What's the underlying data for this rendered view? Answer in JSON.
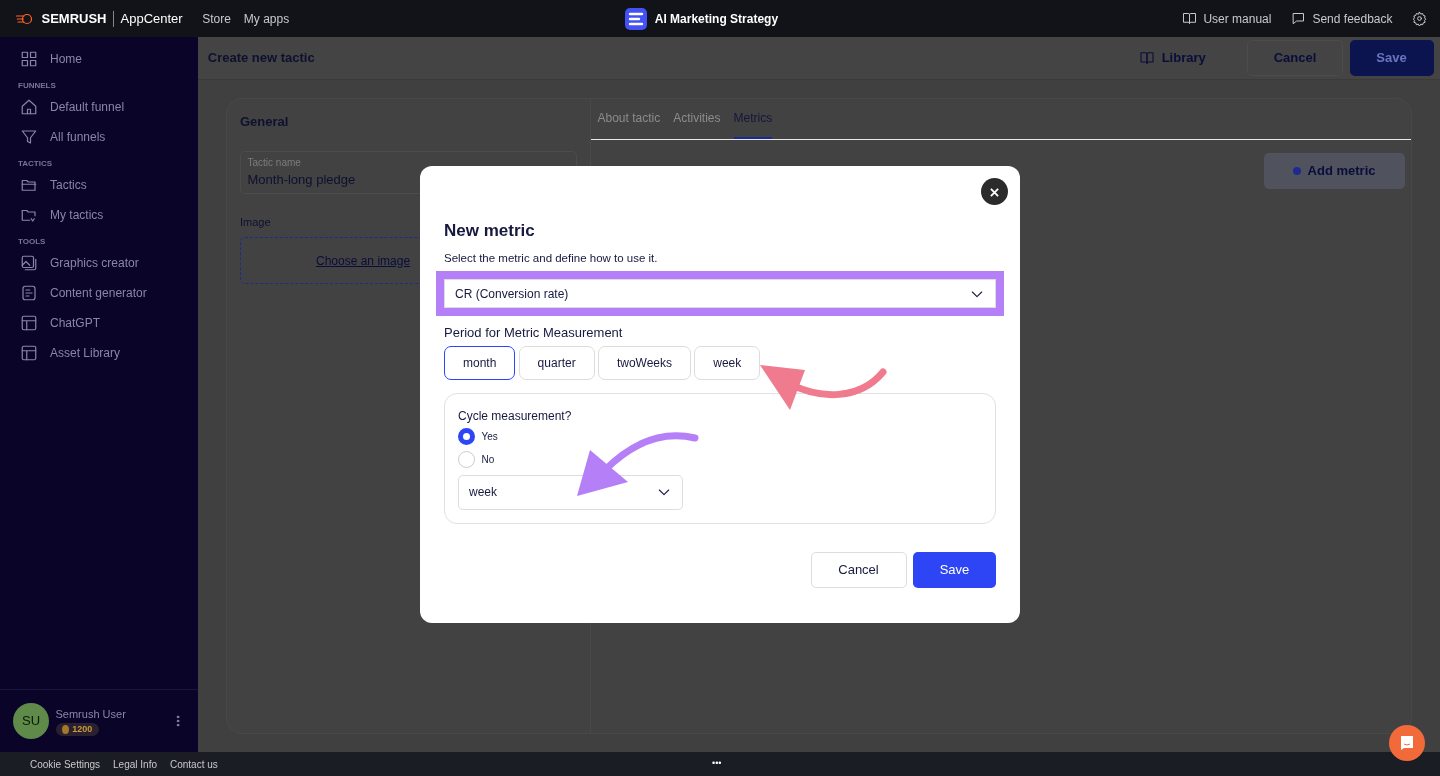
{
  "topbar": {
    "brand": "SEMRUSH",
    "brand_suffix": "AppCenter",
    "nav": [
      "Store",
      "My apps"
    ],
    "app_title": "AI Marketing Strategy",
    "links": [
      {
        "kind": "manual",
        "label": "User manual"
      },
      {
        "kind": "feedback",
        "label": "Send feedback"
      }
    ]
  },
  "sidebar": {
    "sections": [
      {
        "items": [
          {
            "kind": "grid",
            "label": "Home"
          }
        ]
      },
      {
        "heading": "FUNNELS",
        "items": [
          {
            "kind": "house",
            "label": "Default funnel"
          },
          {
            "kind": "funnel",
            "label": "All funnels"
          }
        ]
      },
      {
        "heading": "TACTICS",
        "items": [
          {
            "kind": "folder",
            "label": "Tactics"
          },
          {
            "kind": "folder-my",
            "label": "My tactics"
          }
        ]
      },
      {
        "heading": "TOOLS",
        "items": [
          {
            "kind": "picture",
            "label": "Graphics creator"
          },
          {
            "kind": "doc",
            "label": "Content generator"
          },
          {
            "kind": "layout",
            "label": "ChatGPT"
          },
          {
            "kind": "layout",
            "label": "Asset Library"
          }
        ]
      }
    ],
    "user": {
      "initials": "SU",
      "name": "Semrush User",
      "credits": "1200"
    }
  },
  "page": {
    "title": "Create new tactic",
    "library": "Library",
    "cancel": "Cancel",
    "save": "Save"
  },
  "general": {
    "heading": "General",
    "field_label": "Tactic name",
    "field_value": "Month-long pledge",
    "image_label": "Image",
    "upload_link": "Choose an image"
  },
  "tabs": [
    {
      "label": "About tactic",
      "selected": false
    },
    {
      "label": "Activities",
      "selected": false
    },
    {
      "label": "Metrics",
      "selected": true
    }
  ],
  "add_metric": "Add metric",
  "modal": {
    "title": "New metric",
    "subtitle": "Select the metric and define how to use it.",
    "metric": "CR (Conversion rate)",
    "period_label": "Period for Metric Measurement",
    "periods": [
      {
        "label": "month",
        "selected": true
      },
      {
        "label": "quarter",
        "selected": false
      },
      {
        "label": "twoWeeks",
        "selected": false
      },
      {
        "label": "week",
        "selected": false
      }
    ],
    "cycle_label": "Cycle measurement?",
    "cycle_options": [
      {
        "label": "Yes",
        "selected": true
      },
      {
        "label": "No",
        "selected": false
      }
    ],
    "cycle_period": "week",
    "cancel": "Cancel",
    "save": "Save"
  },
  "annotations": [
    {
      "kind": "curved-arrow-left",
      "color": "#f07a8e"
    },
    {
      "kind": "curved-arrow-down",
      "color": "#b57ff7"
    }
  ],
  "footer": {
    "links": [
      "Cookie Settings",
      "Legal Info",
      "Contact us"
    ],
    "more": "•••"
  }
}
